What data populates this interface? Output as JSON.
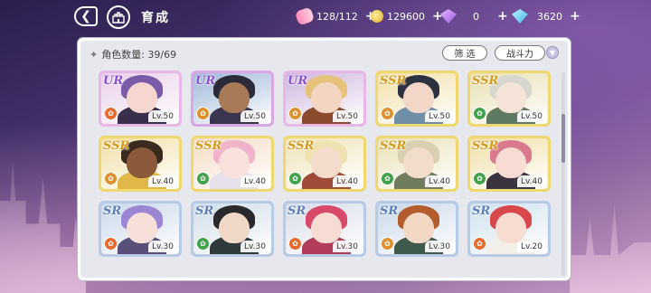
{
  "header": {
    "title": "育成",
    "resources": [
      {
        "icon": "candy-icon",
        "value": "128/112"
      },
      {
        "icon": "gold-coin-icon",
        "value": "129600"
      },
      {
        "icon": "purple-gem-icon",
        "value": "0"
      },
      {
        "icon": "blue-diamond-icon",
        "value": "3620"
      }
    ]
  },
  "panel": {
    "count_label": "角色数量: 39/69",
    "filter_label": "筛 选",
    "sort_label": "战斗力"
  },
  "cards": [
    {
      "rarity": "UR",
      "level": "Lv.50",
      "frame": "#e7b7e6",
      "attr_color": "#e86a2e",
      "hair": "#7a5ba8",
      "skin": "#f6d7cf",
      "cloth": "#3a2f4a",
      "bg": "#e9cfe9"
    },
    {
      "rarity": "UR",
      "level": "Lv.50",
      "frame": "#d9a8e4",
      "attr_color": "#e0902a",
      "hair": "#2a2a38",
      "skin": "#a87a58",
      "cloth": "#3b3550",
      "bg": "#9fb7d8"
    },
    {
      "rarity": "UR",
      "level": "Lv.50",
      "frame": "#e7b7e6",
      "attr_color": "#e0902a",
      "hair": "#e7c27a",
      "skin": "#f3d6c2",
      "cloth": "#8a4a2e",
      "bg": "#cfb6de"
    },
    {
      "rarity": "SSR",
      "level": "Lv.50",
      "frame": "#f0d870",
      "attr_color": "#e0902a",
      "hair": "#2c3140",
      "skin": "#f2d7c9",
      "cloth": "#6e8fa6",
      "bg": "#f1dfa6"
    },
    {
      "rarity": "SSR",
      "level": "Lv.50",
      "frame": "#f0d870",
      "attr_color": "#3fa34a",
      "hair": "#d8d7cf",
      "skin": "#f4e3d6",
      "cloth": "#5e7a62",
      "bg": "#e8dfb3"
    },
    {
      "rarity": "SSR",
      "level": "Lv.40",
      "frame": "#f0d870",
      "attr_color": "#e0902a",
      "hair": "#3a2a1e",
      "skin": "#8b5a3a",
      "cloth": "#e0b84a",
      "bg": "#f1dfa6"
    },
    {
      "rarity": "SSR",
      "level": "Lv.40",
      "frame": "#f0d870",
      "attr_color": "#3fa34a",
      "hair": "#f0b3c9",
      "skin": "#f8e1da",
      "cloth": "#e6e0ea",
      "bg": "#f4dcc4"
    },
    {
      "rarity": "SSR",
      "level": "Lv.40",
      "frame": "#f0d870",
      "attr_color": "#3fa34a",
      "hair": "#efe2b0",
      "skin": "#f3dccb",
      "cloth": "#9e4b3a",
      "bg": "#efe3b8"
    },
    {
      "rarity": "SSR",
      "level": "Lv.40",
      "frame": "#f0d870",
      "attr_color": "#3fa34a",
      "hair": "#d9cfb2",
      "skin": "#f2dccb",
      "cloth": "#6f7c5e",
      "bg": "#e9e0b6"
    },
    {
      "rarity": "SSR",
      "level": "Lv.40",
      "frame": "#f0d870",
      "attr_color": "#3fa34a",
      "hair": "#d8798e",
      "skin": "#f6dcd2",
      "cloth": "#3a3340",
      "bg": "#f1dfa6"
    },
    {
      "rarity": "SR",
      "level": "Lv.30",
      "frame": "#b7cbe6",
      "attr_color": "#e86a2e",
      "hair": "#9b86d4",
      "skin": "#f7e0da",
      "cloth": "#5a4f7a",
      "bg": "#c9d8ea"
    },
    {
      "rarity": "SR",
      "level": "Lv.30",
      "frame": "#b7cbe6",
      "attr_color": "#3fa34a",
      "hair": "#2a2a2e",
      "skin": "#f1d9c8",
      "cloth": "#2f3a3c",
      "bg": "#cfdde8"
    },
    {
      "rarity": "SR",
      "level": "Lv.30",
      "frame": "#b7cbe6",
      "attr_color": "#e86a2e",
      "hair": "#d84a6a",
      "skin": "#f7dcd3",
      "cloth": "#b23c5a",
      "bg": "#d8dce8"
    },
    {
      "rarity": "SR",
      "level": "Lv.30",
      "frame": "#b7cbe6",
      "attr_color": "#e0902a",
      "hair": "#b35c2e",
      "skin": "#f4d8c6",
      "cloth": "#3e5a4a",
      "bg": "#c9d8ea"
    },
    {
      "rarity": "SR",
      "level": "Lv.20",
      "frame": "#b7cbe6",
      "attr_color": "#e86a2e",
      "hair": "#d8474a",
      "skin": "#f7ddd1",
      "cloth": "#f2efe8",
      "bg": "#cfe2ee"
    }
  ]
}
